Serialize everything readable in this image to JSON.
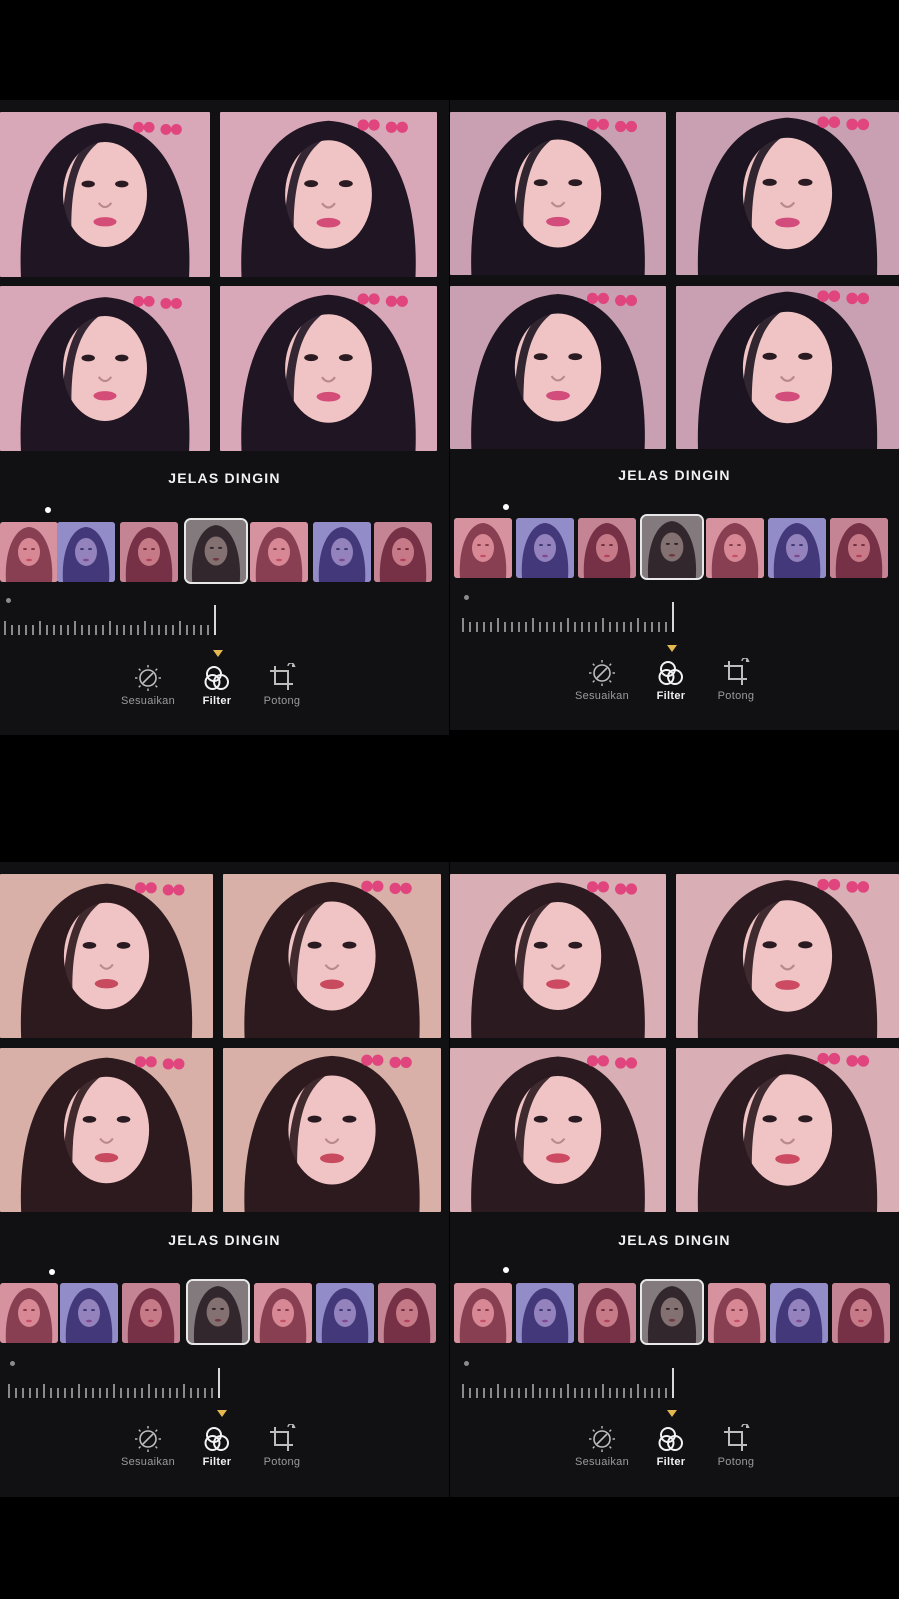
{
  "panels": [
    {
      "filter_name": "JELAS DINGIN",
      "tools": [
        {
          "label": "Sesuaikan"
        },
        {
          "label": "Filter"
        },
        {
          "label": "Potong"
        }
      ]
    },
    {
      "filter_name": "JELAS DINGIN",
      "tools": [
        {
          "label": "Sesuaikan"
        },
        {
          "label": "Filter"
        },
        {
          "label": "Potong"
        }
      ]
    },
    {
      "filter_name": "JELAS DINGIN",
      "tools": [
        {
          "label": "Sesuaikan"
        },
        {
          "label": "Filter"
        },
        {
          "label": "Potong"
        }
      ]
    },
    {
      "filter_name": "JELAS DINGIN",
      "tools": [
        {
          "label": "Sesuaikan"
        },
        {
          "label": "Filter"
        },
        {
          "label": "Potong"
        }
      ]
    }
  ],
  "photo_tone": [
    "#d9a8b8",
    "#c9a0b2",
    "#d8b0a8",
    "#d9aeb4"
  ],
  "thumb_tints": [
    "#c85a70",
    "#4a4fb8",
    "#a8405a",
    "#2e2e2e",
    "#c85a70",
    "#4a4fb8",
    "#a8405a"
  ],
  "selected_filter_index": 3,
  "icons": [
    "adjust-icon",
    "filter-icon",
    "crop-icon"
  ]
}
